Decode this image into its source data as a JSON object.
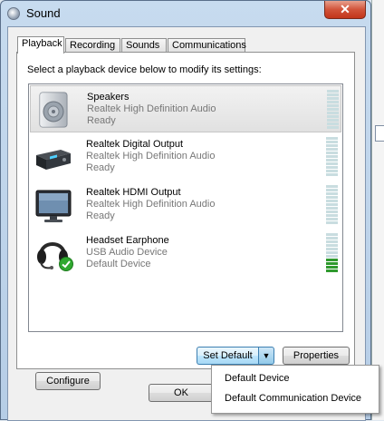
{
  "window": {
    "title": "Sound",
    "close_label": "✕"
  },
  "tabs": [
    {
      "label": "Playback",
      "active": true
    },
    {
      "label": "Recording",
      "active": false
    },
    {
      "label": "Sounds",
      "active": false
    },
    {
      "label": "Communications",
      "active": false
    }
  ],
  "instruction": "Select a playback device below to modify its settings:",
  "devices": [
    {
      "name": "Speakers",
      "driver": "Realtek High Definition Audio",
      "status": "Ready",
      "icon": "speaker-icon",
      "selected": true,
      "level_bars": 0
    },
    {
      "name": "Realtek Digital Output",
      "driver": "Realtek High Definition Audio",
      "status": "Ready",
      "icon": "digital-output-icon",
      "selected": false,
      "level_bars": 0
    },
    {
      "name": "Realtek HDMI Output",
      "driver": "Realtek High Definition Audio",
      "status": "Ready",
      "icon": "hdmi-monitor-icon",
      "selected": false,
      "level_bars": 0
    },
    {
      "name": "Headset Earphone",
      "driver": "USB Audio Device",
      "status": "Default Device",
      "icon": "headset-icon",
      "selected": false,
      "level_bars": 4
    }
  ],
  "buttons": {
    "configure": "Configure",
    "set_default": "Set Default",
    "properties": "Properties",
    "ok": "OK"
  },
  "set_default_menu": [
    "Default Device",
    "Default Communication Device"
  ],
  "colors": {
    "meter_on": "#2f9a2e",
    "meter_off": "#c9dde0",
    "default_check": "#2fa82f"
  }
}
